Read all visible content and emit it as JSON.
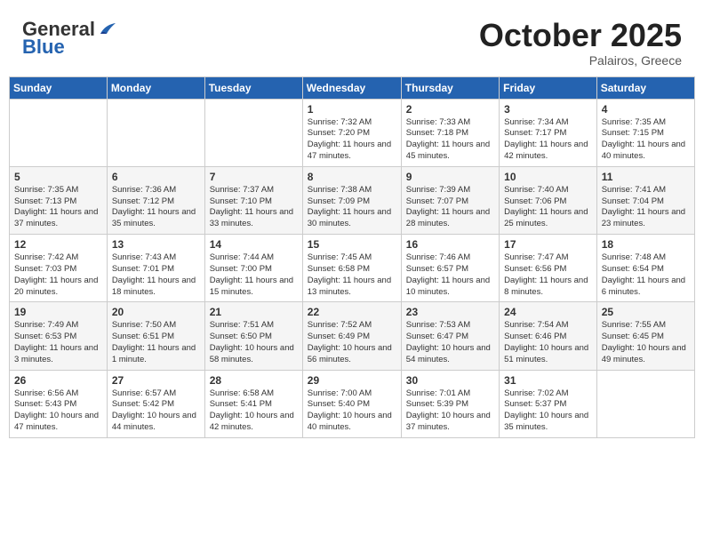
{
  "header": {
    "logo_general": "General",
    "logo_blue": "Blue",
    "month": "October 2025",
    "location": "Palairos, Greece"
  },
  "days_of_week": [
    "Sunday",
    "Monday",
    "Tuesday",
    "Wednesday",
    "Thursday",
    "Friday",
    "Saturday"
  ],
  "weeks": [
    [
      {
        "day": "",
        "info": ""
      },
      {
        "day": "",
        "info": ""
      },
      {
        "day": "",
        "info": ""
      },
      {
        "day": "1",
        "info": "Sunrise: 7:32 AM\nSunset: 7:20 PM\nDaylight: 11 hours and 47 minutes."
      },
      {
        "day": "2",
        "info": "Sunrise: 7:33 AM\nSunset: 7:18 PM\nDaylight: 11 hours and 45 minutes."
      },
      {
        "day": "3",
        "info": "Sunrise: 7:34 AM\nSunset: 7:17 PM\nDaylight: 11 hours and 42 minutes."
      },
      {
        "day": "4",
        "info": "Sunrise: 7:35 AM\nSunset: 7:15 PM\nDaylight: 11 hours and 40 minutes."
      }
    ],
    [
      {
        "day": "5",
        "info": "Sunrise: 7:35 AM\nSunset: 7:13 PM\nDaylight: 11 hours and 37 minutes."
      },
      {
        "day": "6",
        "info": "Sunrise: 7:36 AM\nSunset: 7:12 PM\nDaylight: 11 hours and 35 minutes."
      },
      {
        "day": "7",
        "info": "Sunrise: 7:37 AM\nSunset: 7:10 PM\nDaylight: 11 hours and 33 minutes."
      },
      {
        "day": "8",
        "info": "Sunrise: 7:38 AM\nSunset: 7:09 PM\nDaylight: 11 hours and 30 minutes."
      },
      {
        "day": "9",
        "info": "Sunrise: 7:39 AM\nSunset: 7:07 PM\nDaylight: 11 hours and 28 minutes."
      },
      {
        "day": "10",
        "info": "Sunrise: 7:40 AM\nSunset: 7:06 PM\nDaylight: 11 hours and 25 minutes."
      },
      {
        "day": "11",
        "info": "Sunrise: 7:41 AM\nSunset: 7:04 PM\nDaylight: 11 hours and 23 minutes."
      }
    ],
    [
      {
        "day": "12",
        "info": "Sunrise: 7:42 AM\nSunset: 7:03 PM\nDaylight: 11 hours and 20 minutes."
      },
      {
        "day": "13",
        "info": "Sunrise: 7:43 AM\nSunset: 7:01 PM\nDaylight: 11 hours and 18 minutes."
      },
      {
        "day": "14",
        "info": "Sunrise: 7:44 AM\nSunset: 7:00 PM\nDaylight: 11 hours and 15 minutes."
      },
      {
        "day": "15",
        "info": "Sunrise: 7:45 AM\nSunset: 6:58 PM\nDaylight: 11 hours and 13 minutes."
      },
      {
        "day": "16",
        "info": "Sunrise: 7:46 AM\nSunset: 6:57 PM\nDaylight: 11 hours and 10 minutes."
      },
      {
        "day": "17",
        "info": "Sunrise: 7:47 AM\nSunset: 6:56 PM\nDaylight: 11 hours and 8 minutes."
      },
      {
        "day": "18",
        "info": "Sunrise: 7:48 AM\nSunset: 6:54 PM\nDaylight: 11 hours and 6 minutes."
      }
    ],
    [
      {
        "day": "19",
        "info": "Sunrise: 7:49 AM\nSunset: 6:53 PM\nDaylight: 11 hours and 3 minutes."
      },
      {
        "day": "20",
        "info": "Sunrise: 7:50 AM\nSunset: 6:51 PM\nDaylight: 11 hours and 1 minute."
      },
      {
        "day": "21",
        "info": "Sunrise: 7:51 AM\nSunset: 6:50 PM\nDaylight: 10 hours and 58 minutes."
      },
      {
        "day": "22",
        "info": "Sunrise: 7:52 AM\nSunset: 6:49 PM\nDaylight: 10 hours and 56 minutes."
      },
      {
        "day": "23",
        "info": "Sunrise: 7:53 AM\nSunset: 6:47 PM\nDaylight: 10 hours and 54 minutes."
      },
      {
        "day": "24",
        "info": "Sunrise: 7:54 AM\nSunset: 6:46 PM\nDaylight: 10 hours and 51 minutes."
      },
      {
        "day": "25",
        "info": "Sunrise: 7:55 AM\nSunset: 6:45 PM\nDaylight: 10 hours and 49 minutes."
      }
    ],
    [
      {
        "day": "26",
        "info": "Sunrise: 6:56 AM\nSunset: 5:43 PM\nDaylight: 10 hours and 47 minutes."
      },
      {
        "day": "27",
        "info": "Sunrise: 6:57 AM\nSunset: 5:42 PM\nDaylight: 10 hours and 44 minutes."
      },
      {
        "day": "28",
        "info": "Sunrise: 6:58 AM\nSunset: 5:41 PM\nDaylight: 10 hours and 42 minutes."
      },
      {
        "day": "29",
        "info": "Sunrise: 7:00 AM\nSunset: 5:40 PM\nDaylight: 10 hours and 40 minutes."
      },
      {
        "day": "30",
        "info": "Sunrise: 7:01 AM\nSunset: 5:39 PM\nDaylight: 10 hours and 37 minutes."
      },
      {
        "day": "31",
        "info": "Sunrise: 7:02 AM\nSunset: 5:37 PM\nDaylight: 10 hours and 35 minutes."
      },
      {
        "day": "",
        "info": ""
      }
    ]
  ]
}
